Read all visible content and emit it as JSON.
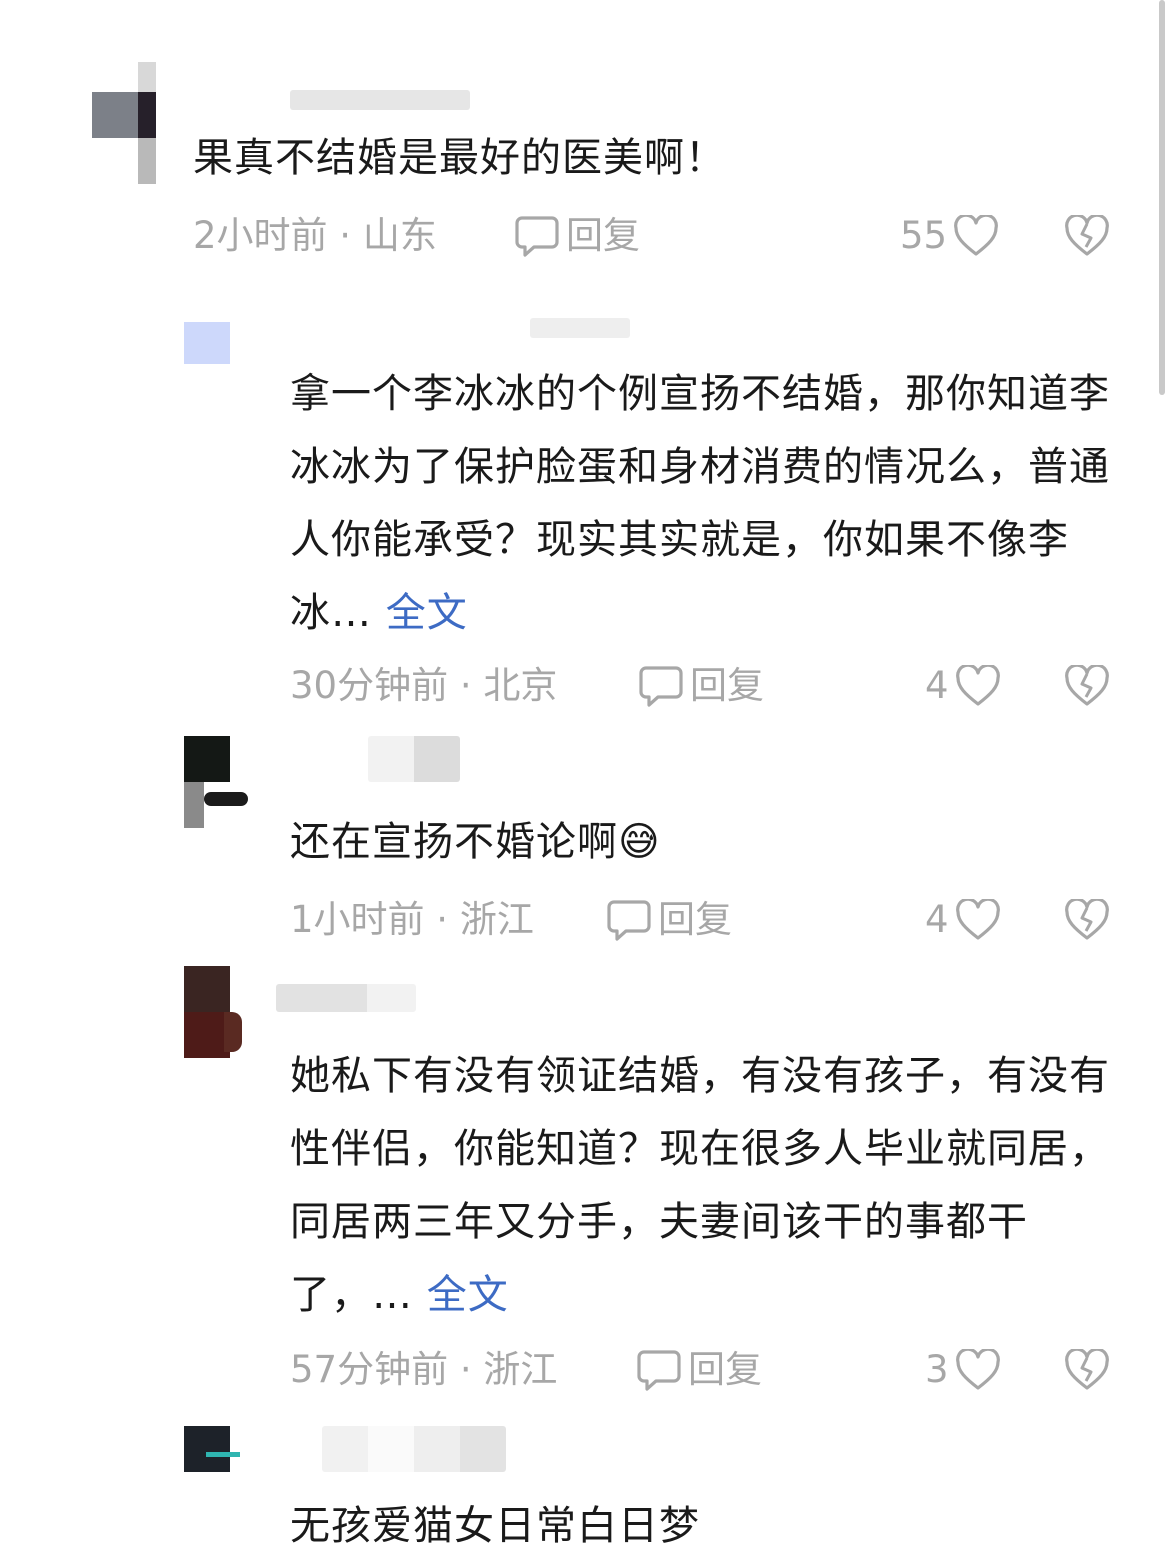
{
  "comments": [
    {
      "username": "",
      "text": "果真不结婚是最好的医美啊！",
      "more_link": "",
      "time_location": "2小时前 · 山东",
      "reply_label": "回复",
      "likes": "55"
    },
    {
      "username": "",
      "text": "拿一个李冰冰的个例宣扬不结婚，那你知道李冰冰为了保护脸蛋和身材消费的情况么，普通人你能承受？现实其实就是，你如果不像李冰…",
      "more_link": "全文",
      "time_location": "30分钟前 · 北京",
      "reply_label": "回复",
      "likes": "4"
    },
    {
      "username": "",
      "text": "还在宣扬不婚论啊",
      "emoji": "😅",
      "more_link": "",
      "time_location": "1小时前 · 浙江",
      "reply_label": "回复",
      "likes": "4"
    },
    {
      "username": "",
      "text": "她私下有没有领证结婚，有没有孩子，有没有性伴侣，你能知道？现在很多人毕业就同居，同居两三年又分手，夫妻间该干的事都干了，…",
      "more_link": "全文",
      "time_location": "57分钟前 · 浙江",
      "reply_label": "回复",
      "likes": "3"
    },
    {
      "username": "",
      "text": "无孩爱猫女日常白日梦",
      "more_link": ""
    }
  ],
  "icons": {
    "reply": "speech-bubble-icon",
    "like": "heart-outline-icon",
    "dislike": "broken-heart-icon"
  },
  "colors": {
    "link": "#3d6bc4",
    "meta": "#a7a7a7",
    "text": "#1a1a1a"
  }
}
